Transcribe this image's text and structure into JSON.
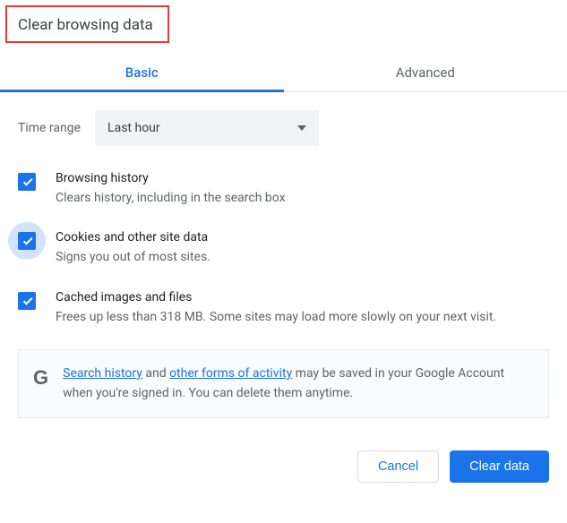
{
  "dialog": {
    "title": "Clear browsing data"
  },
  "tabs": {
    "basic": "Basic",
    "advanced": "Advanced"
  },
  "time_range": {
    "label": "Time range",
    "selected": "Last hour"
  },
  "options": {
    "browsing_history": {
      "title": "Browsing history",
      "desc": "Clears history, including in the search box",
      "checked": true
    },
    "cookies": {
      "title": "Cookies and other site data",
      "desc": "Signs you out of most sites.",
      "checked": true
    },
    "cache": {
      "title": "Cached images and files",
      "desc": "Frees up less than 318 MB. Some sites may load more slowly on your next visit.",
      "checked": true
    }
  },
  "info": {
    "link1": "Search history",
    "mid1": " and ",
    "link2": "other forms of activity",
    "rest": " may be saved in your Google Account when you're signed in. You can delete them anytime."
  },
  "buttons": {
    "cancel": "Cancel",
    "clear": "Clear data"
  }
}
